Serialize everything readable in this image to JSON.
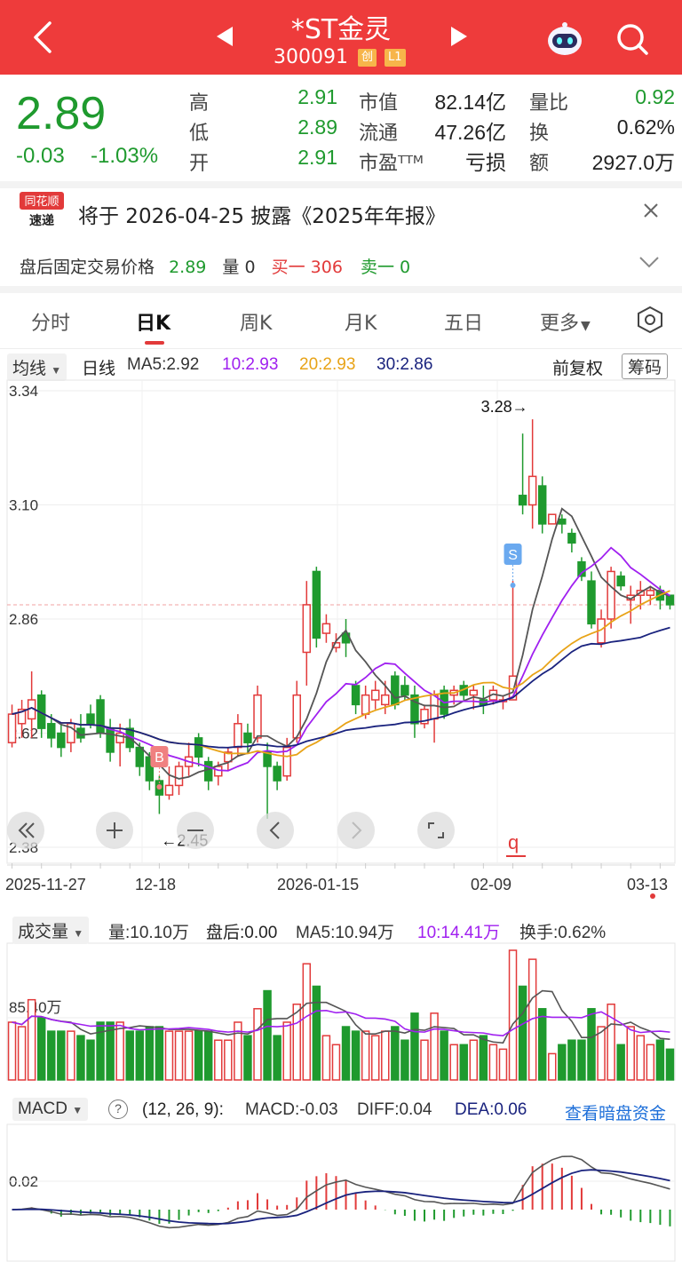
{
  "header": {
    "title": "*ST金灵",
    "code": "300091",
    "badge_chuang": "创",
    "badge_l1": "L1"
  },
  "quote": {
    "price": "2.89",
    "change": "-0.03",
    "change_pct": "-1.03%",
    "high_label": "高",
    "high": "2.91",
    "low_label": "低",
    "low": "2.89",
    "open_label": "开",
    "open": "2.91",
    "mcap_label": "市值",
    "mcap": "82.14亿",
    "float_label": "流通",
    "float": "47.26亿",
    "pe_label": "市盈ᵀᵀᴹ",
    "pe": "亏损",
    "volratio_label": "量比",
    "volratio": "0.92",
    "turnover_label": "换",
    "turnover": "0.62%",
    "amount_label": "额",
    "amount": "2927.0万"
  },
  "notice": {
    "logo_top": "同花顺",
    "logo_bottom": "速递",
    "text": "将于 2026-04-25 披露《2025年年报》"
  },
  "after_hours": {
    "label": "盘后固定交易价格",
    "price": "2.89",
    "vol_label": "量 0",
    "buy": "买一 306",
    "sell": "卖一 0"
  },
  "tabs": [
    "分时",
    "日K",
    "周K",
    "月K",
    "五日",
    "更多"
  ],
  "ma_legend": {
    "select": "均线",
    "period": "日线",
    "ma5": "MA5:2.92",
    "ma10": "10:2.93",
    "ma20": "20:2.93",
    "ma30": "30:2.86",
    "adjust": "前复权",
    "chips": "筹码"
  },
  "vol_legend": {
    "select": "成交量",
    "vol": "量:10.10万",
    "after": "盘后:0.00",
    "ma5": "MA5:10.94万",
    "ma10": "10:14.41万",
    "turn": "换手:0.62%"
  },
  "macd_legend": {
    "select": "MACD",
    "help": "?",
    "params": "(12, 26, 9):",
    "macd": "MACD:-0.03",
    "diff": "DIFF:0.04",
    "dea": "DEA:0.06",
    "link": "查看暗盘资金"
  },
  "colors": {
    "red": "#e23a3a",
    "green": "#1f9a2e",
    "ma5": "#555555",
    "ma10": "#a020f0",
    "ma20": "#e8a317",
    "ma30": "#1a237e",
    "header": "#ee3b3b"
  },
  "chart_data": [
    {
      "type": "candlestick",
      "y_ticks": [
        "3.34",
        "3.10",
        "2.86",
        "2.62",
        "2.38"
      ],
      "ylim": [
        2.38,
        3.34
      ],
      "x_ticks": [
        "2025-11-27",
        "12-18",
        "2026-01-15",
        "02-09",
        "03-13"
      ],
      "annotations": {
        "max": "3.28→",
        "min": "←2.45",
        "s": "S",
        "b": "B",
        "q": "q"
      },
      "candles": [
        [
          2.6,
          2.66,
          2.59,
          2.68
        ],
        [
          2.64,
          2.67,
          2.61,
          2.69
        ],
        [
          2.65,
          2.69,
          2.61,
          2.75
        ],
        [
          2.7,
          2.63,
          2.61,
          2.71
        ],
        [
          2.64,
          2.61,
          2.59,
          2.66
        ],
        [
          2.62,
          2.59,
          2.57,
          2.64
        ],
        [
          2.6,
          2.64,
          2.58,
          2.65
        ],
        [
          2.63,
          2.61,
          2.6,
          2.66
        ],
        [
          2.66,
          2.64,
          2.63,
          2.68
        ],
        [
          2.69,
          2.62,
          2.61,
          2.7
        ],
        [
          2.63,
          2.58,
          2.56,
          2.65
        ],
        [
          2.6,
          2.62,
          2.55,
          2.64
        ],
        [
          2.63,
          2.59,
          2.58,
          2.65
        ],
        [
          2.59,
          2.55,
          2.53,
          2.6
        ],
        [
          2.57,
          2.52,
          2.5,
          2.58
        ],
        [
          2.52,
          2.49,
          2.45,
          2.53
        ],
        [
          2.49,
          2.51,
          2.48,
          2.55
        ],
        [
          2.51,
          2.55,
          2.49,
          2.56
        ],
        [
          2.55,
          2.57,
          2.53,
          2.6
        ],
        [
          2.61,
          2.57,
          2.55,
          2.62
        ],
        [
          2.56,
          2.52,
          2.5,
          2.57
        ],
        [
          2.53,
          2.55,
          2.51,
          2.56
        ],
        [
          2.56,
          2.58,
          2.54,
          2.59
        ],
        [
          2.59,
          2.64,
          2.57,
          2.66
        ],
        [
          2.62,
          2.6,
          2.58,
          2.64
        ],
        [
          2.61,
          2.7,
          2.6,
          2.72
        ],
        [
          2.58,
          2.55,
          2.44,
          2.6
        ],
        [
          2.55,
          2.52,
          2.5,
          2.56
        ],
        [
          2.53,
          2.59,
          2.52,
          2.61
        ],
        [
          2.61,
          2.7,
          2.6,
          2.73
        ],
        [
          2.79,
          2.89,
          2.72,
          2.94
        ],
        [
          2.96,
          2.82,
          2.8,
          2.97
        ],
        [
          2.83,
          2.85,
          2.81,
          2.87
        ],
        [
          2.8,
          2.81,
          2.79,
          2.83
        ],
        [
          2.83,
          2.81,
          2.78,
          2.86
        ],
        [
          2.72,
          2.68,
          2.66,
          2.73
        ],
        [
          2.66,
          2.7,
          2.65,
          2.72
        ],
        [
          2.69,
          2.71,
          2.67,
          2.73
        ],
        [
          2.68,
          2.7,
          2.66,
          2.73
        ],
        [
          2.74,
          2.68,
          2.67,
          2.75
        ],
        [
          2.72,
          2.7,
          2.69,
          2.74
        ],
        [
          2.7,
          2.64,
          2.61,
          2.72
        ],
        [
          2.64,
          2.67,
          2.63,
          2.68
        ],
        [
          2.65,
          2.7,
          2.6,
          2.71
        ],
        [
          2.71,
          2.66,
          2.65,
          2.72
        ],
        [
          2.7,
          2.71,
          2.68,
          2.72
        ],
        [
          2.72,
          2.7,
          2.69,
          2.73
        ],
        [
          2.7,
          2.71,
          2.67,
          2.72
        ],
        [
          2.69,
          2.68,
          2.66,
          2.72
        ],
        [
          2.69,
          2.71,
          2.68,
          2.72
        ],
        [
          2.69,
          2.69,
          2.67,
          2.7
        ],
        [
          2.69,
          2.74,
          2.69,
          2.94
        ],
        [
          3.12,
          3.1,
          3.08,
          3.25
        ],
        [
          3.1,
          3.16,
          3.05,
          3.28
        ],
        [
          3.14,
          3.06,
          3.04,
          3.16
        ],
        [
          3.06,
          3.08,
          3.06,
          3.08
        ],
        [
          3.07,
          3.06,
          3.04,
          3.08
        ],
        [
          3.04,
          3.02,
          3.0,
          3.05
        ],
        [
          2.98,
          2.95,
          2.94,
          2.99
        ],
        [
          2.94,
          2.85,
          2.84,
          2.96
        ],
        [
          2.81,
          2.86,
          2.8,
          2.88
        ],
        [
          2.86,
          2.96,
          2.84,
          2.97
        ],
        [
          2.95,
          2.93,
          2.92,
          2.96
        ],
        [
          2.9,
          2.91,
          2.85,
          2.93
        ],
        [
          2.91,
          2.92,
          2.88,
          2.94
        ],
        [
          2.91,
          2.92,
          2.89,
          2.93
        ],
        [
          2.92,
          2.9,
          2.88,
          2.93
        ],
        [
          2.91,
          2.89,
          2.88,
          2.91
        ]
      ]
    },
    {
      "type": "bar",
      "title": "成交量",
      "y_ticks": [
        "85.40万"
      ]
    },
    {
      "type": "bar",
      "title": "MACD",
      "y_ticks": [
        "0.02"
      ]
    }
  ]
}
